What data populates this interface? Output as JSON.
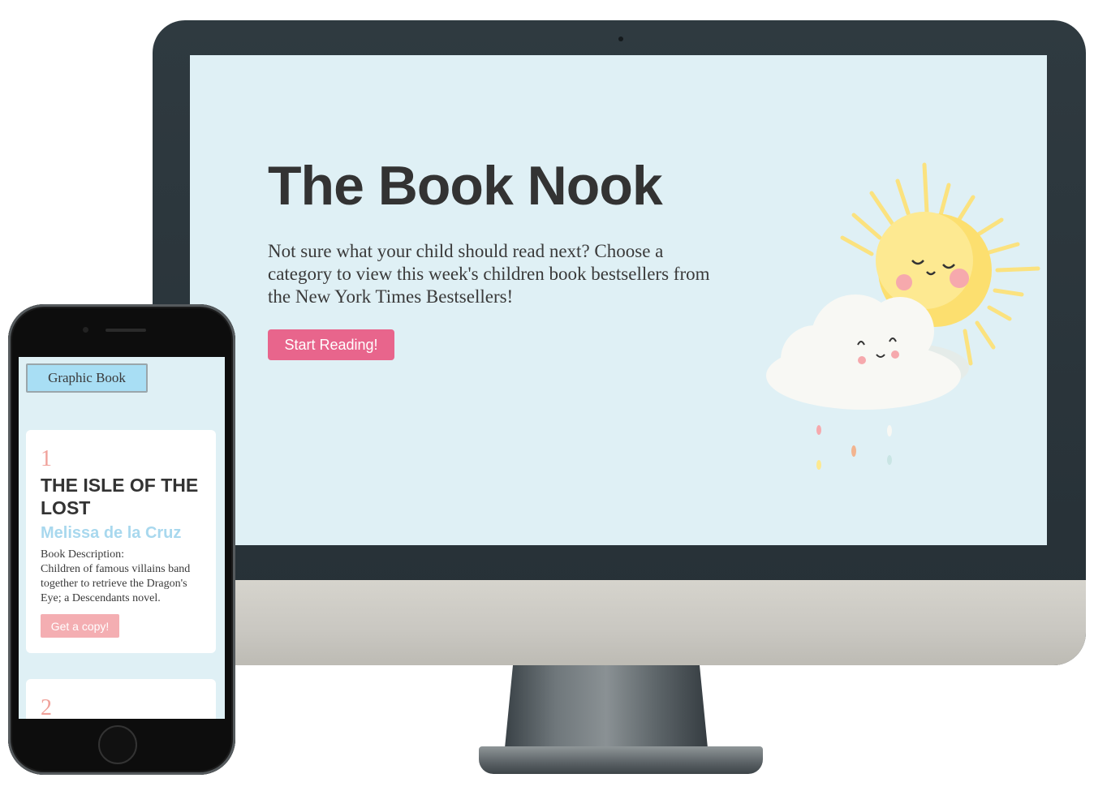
{
  "desktop": {
    "title": "The Book Nook",
    "description": "Not sure what your child should read next? Choose a category to view this week's children book bestsellers from the New York Times Bestsellers!",
    "cta_label": "Start Reading!",
    "illustration": "sun-and-cloud-illustration",
    "colors": {
      "background": "#dff0f5",
      "accent": "#e8658c",
      "heading": "#333333"
    }
  },
  "mobile": {
    "category_label": "Graphic Book",
    "books": [
      {
        "rank": "1",
        "title": "THE ISLE OF THE LOST",
        "author": "Melissa de la Cruz",
        "description_label": "Book Description:",
        "description": "Children of famous villains band together to retrieve the Dragon's Eye; a Descendants novel.",
        "button_label": "Get a copy!"
      },
      {
        "rank": "2"
      }
    ],
    "colors": {
      "rank": "#f0a19a",
      "author": "#a8d8ee",
      "button": "#f4aeb2",
      "category": "#a8def4"
    }
  }
}
